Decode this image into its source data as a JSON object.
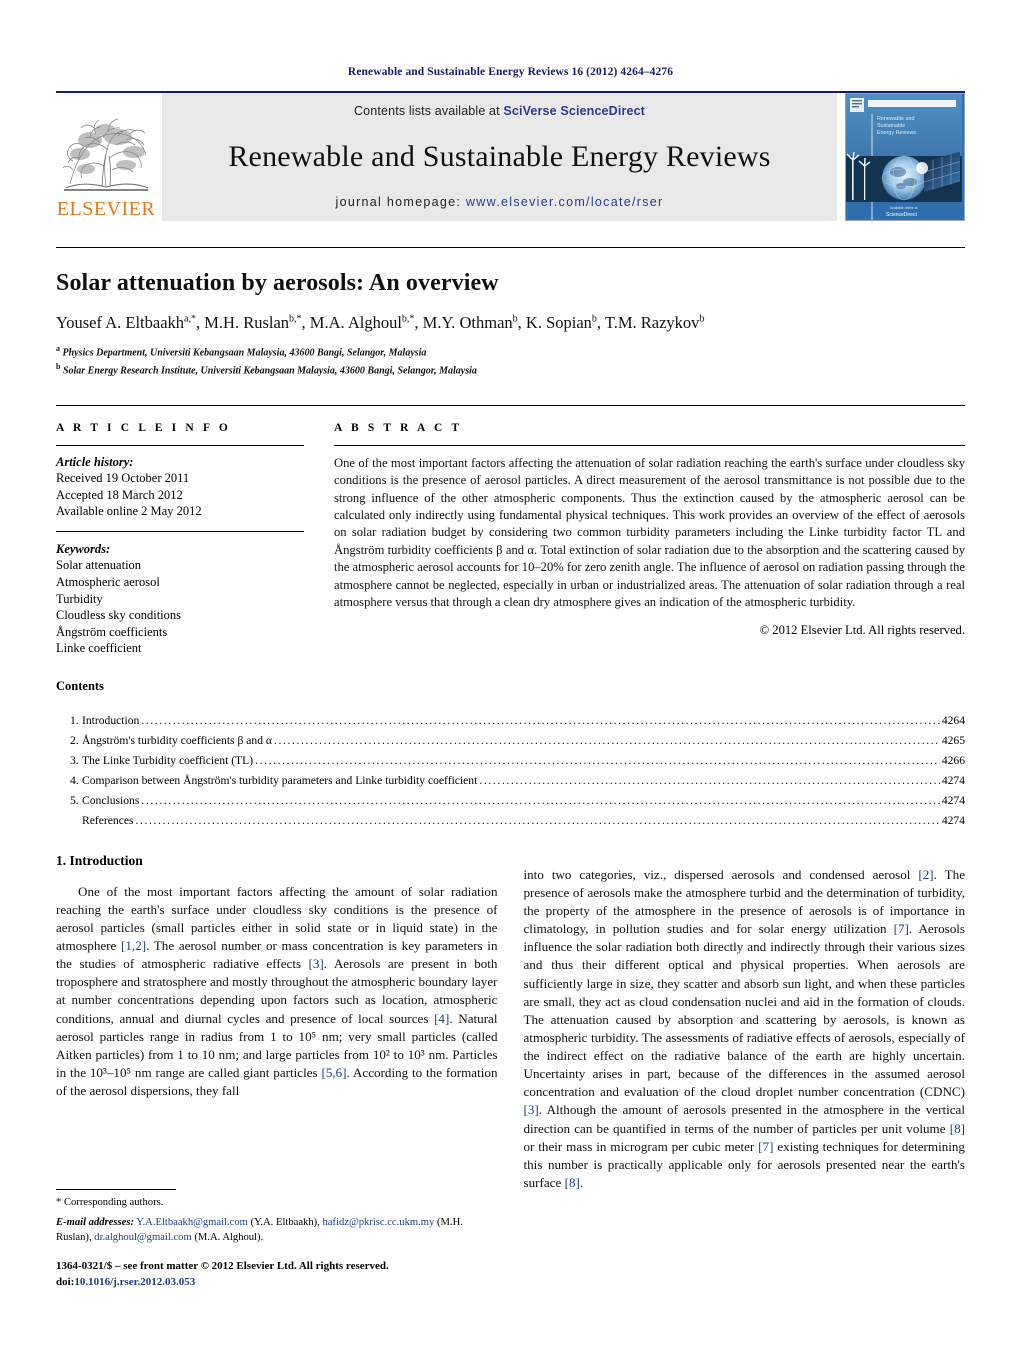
{
  "running_head": "Renewable and Sustainable Energy Reviews 16 (2012) 4264–4276",
  "masthead": {
    "publisher_word": "ELSEVIER",
    "contents_prefix": "Contents lists available at ",
    "contents_link": "SciVerse ScienceDirect",
    "journal_name": "Renewable and Sustainable Energy Reviews",
    "homepage_prefix": "journal homepage: ",
    "homepage_url": "www.elsevier.com/locate/rser",
    "cover_title_lines": [
      "Renewable and",
      "Sustainable",
      "Energy Reviews"
    ],
    "cover_footer": "ScienceDirect",
    "link_color": "#2b3a8f",
    "brand_color": "#E87722",
    "band_color": "#e8e8e8"
  },
  "article": {
    "title": "Solar attenuation by aerosols: An overview",
    "authors_html": "Yousef A. Eltbaakh<sup>a,*</sup>, M.H. Ruslan<sup>b,*</sup>, M.A. Alghoul<sup>b,*</sup>, M.Y. Othman<sup>b</sup>, K. Sopian<sup>b</sup>, T.M. Razykov<sup>b</sup>",
    "affiliation_a": "Physics Department, Universiti Kebangsaan Malaysia, 43600 Bangi, Selangor, Malaysia",
    "affiliation_b": "Solar Energy Research Institute, Universiti Kebangsaan Malaysia, 43600 Bangi, Selangor, Malaysia"
  },
  "article_info": {
    "heading": "A R T I C L E   I N F O",
    "history_label": "Article history:",
    "history": [
      "Received 19 October 2011",
      "Accepted 18 March 2012",
      "Available online 2 May 2012"
    ],
    "keywords_label": "Keywords:",
    "keywords": [
      "Solar attenuation",
      "Atmospheric aerosol",
      "Turbidity",
      "Cloudless sky conditions",
      "Ångström coefficients",
      "Linke coefficient"
    ]
  },
  "abstract": {
    "heading": "A B S T R A C T",
    "text": "One of the most important factors affecting the attenuation of solar radiation reaching the earth's surface under cloudless sky conditions is the presence of aerosol particles. A direct measurement of the aerosol transmittance is not possible due to the strong influence of the other atmospheric components. Thus the extinction caused by the atmospheric aerosol can be calculated only indirectly using fundamental physical techniques. This work provides an overview of the effect of aerosols on solar radiation budget by considering two common turbidity parameters including the Linke turbidity factor TL and Ångström turbidity coefficients β and α. Total extinction of solar radiation due to the absorption and the scattering caused by the atmospheric aerosol accounts for 10–20% for zero zenith angle. The influence of aerosol on radiation passing through the atmosphere cannot be neglected, especially in urban or industrialized areas. The attenuation of solar radiation through a real atmosphere versus that through a clean dry atmosphere gives an indication of the atmospheric turbidity.",
    "copyright": "© 2012 Elsevier Ltd. All rights reserved."
  },
  "contents": {
    "heading": "Contents",
    "items": [
      {
        "num": "1.",
        "label": "Introduction",
        "page": "4264"
      },
      {
        "num": "2.",
        "label": "Ångström's turbidity coefficients β and α",
        "page": "4265"
      },
      {
        "num": "3.",
        "label": "The Linke Turbidity coefficient (TL)",
        "page": "4266"
      },
      {
        "num": "4.",
        "label": "Comparison between Ångström's turbidity parameters and Linke turbidity coefficient",
        "page": "4274"
      },
      {
        "num": "5.",
        "label": "Conclusions",
        "page": "4274"
      },
      {
        "num": "",
        "label": "References",
        "page": "4274"
      }
    ]
  },
  "body": {
    "section_heading": "1.  Introduction",
    "left_paragraph": "One of the most important factors affecting the amount of solar radiation reaching the earth's surface under cloudless sky conditions is the presence of aerosol particles (small particles either in solid state or in liquid state) in the atmosphere [1,2]. The aerosol number or mass concentration is key parameters in the studies of atmospheric radiative effects [3]. Aerosols are present in both troposphere and stratosphere and mostly throughout the atmospheric boundary layer at number concentrations depending upon factors such as location, atmospheric conditions, annual and diurnal cycles and presence of local sources [4]. Natural aerosol particles range in radius from 1 to 10⁵ nm; very small particles (called Aitken particles) from 1 to 10 nm; and large particles from 10² to 10³ nm. Particles in the 10³–10⁵ nm range are called giant particles [5,6]. According to the formation of the aerosol dispersions, they fall",
    "right_paragraph": "into two categories, viz., dispersed aerosols and condensed aerosol [2]. The presence of aerosols make the atmosphere turbid and the determination of turbidity, the property of the atmosphere in the presence of aerosols is of importance in climatology, in pollution studies and for solar energy utilization [7]. Aerosols influence the solar radiation both directly and indirectly through their various sizes and thus their different optical and physical properties. When aerosols are sufficiently large in size, they scatter and absorb sun light, and when these particles are small, they act as cloud condensation nuclei and aid in the formation of clouds. The attenuation caused by absorption and scattering by aerosols, is known as atmospheric turbidity. The assessments of radiative effects of aerosols, especially of the indirect effect on the radiative balance of the earth are highly uncertain. Uncertainty arises in part, because of the differences in the assumed aerosol concentration and evaluation of the cloud droplet number concentration (CDNC) [3]. Although the amount of aerosols presented in the atmosphere in the vertical direction can be quantified in terms of the number of particles per unit volume [8] or their mass in microgram per cubic meter [7] existing techniques for determining this number is practically applicable only for aerosols presented near the earth's surface [8]."
  },
  "footnotes": {
    "corresponding": "* Corresponding authors.",
    "email_label": "E-mail addresses:",
    "email_1": "Y.A.Eltbaakh@gmail.com",
    "email_1_owner": "(Y.A. Eltbaakh),",
    "email_2": "hafidz@pkrisc.cc.ukm.my",
    "email_2_owner": "(M.H. Ruslan),",
    "email_3": "dr.alghoul@gmail.com",
    "email_3_owner": "(M.A. Alghoul).",
    "issn_line": "1364-0321/$ – see front matter © 2012 Elsevier Ltd. All rights reserved.",
    "doi_prefix": "doi:",
    "doi_value": "10.1016/j.rser.2012.03.053"
  }
}
